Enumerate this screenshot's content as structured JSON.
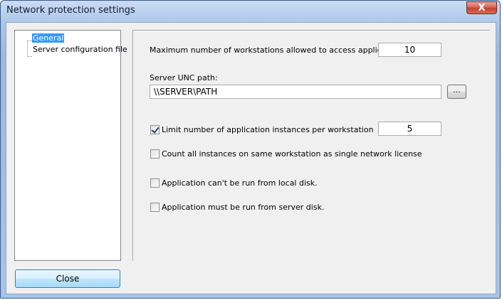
{
  "window": {
    "title": "Network protection settings",
    "close_glyph": "X"
  },
  "tree": {
    "items": [
      {
        "label": "General",
        "selected": true
      },
      {
        "label": "Server configuration file",
        "selected": false
      }
    ]
  },
  "general": {
    "max_workstations_label": "Maximum number of workstations allowed to access application:",
    "max_workstations_value": "10",
    "unc_label": "Server UNC path:",
    "unc_value": "\\\\SERVER\\PATH",
    "browse_label": "...",
    "limit_instances_label": "Limit number of application instances per workstation",
    "limit_instances_checked": true,
    "limit_instances_value": "5",
    "count_single_label": "Count all instances on same workstation as single network license",
    "count_single_checked": false,
    "no_local_label": "Application can't be run from local disk.",
    "no_local_checked": false,
    "server_disk_label": "Application must be run from server disk.",
    "server_disk_checked": false
  },
  "footer": {
    "close_label": "Close"
  }
}
